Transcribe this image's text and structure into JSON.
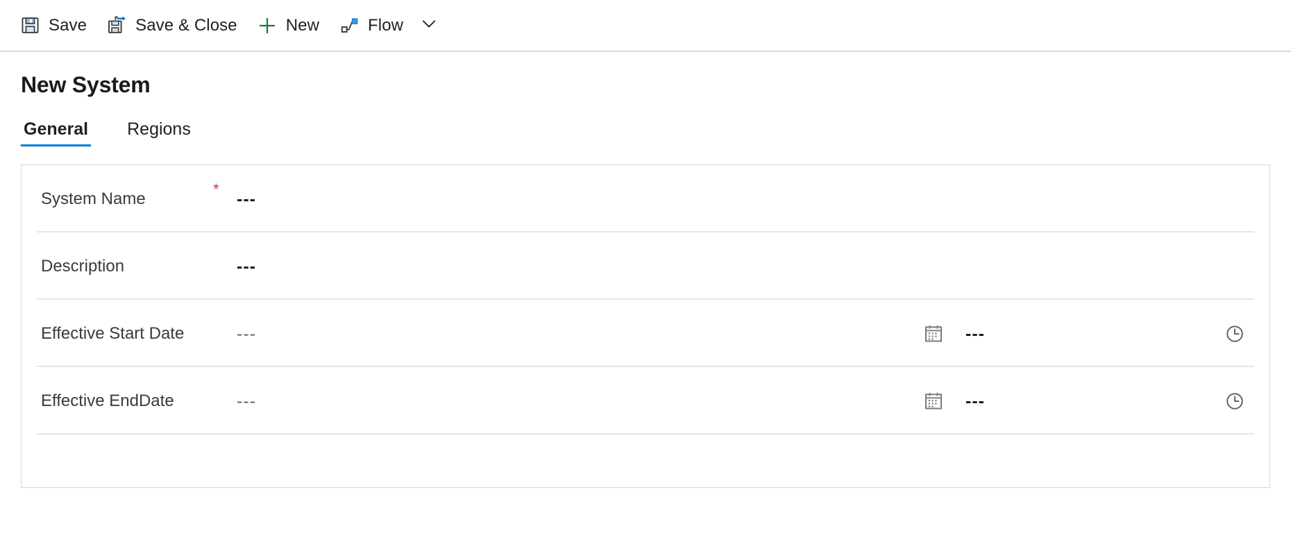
{
  "commandbar": {
    "buttons": [
      {
        "label": "Save",
        "icon": "save-icon"
      },
      {
        "label": "Save & Close",
        "icon": "save-and-close-icon"
      },
      {
        "label": "New",
        "icon": "plus-icon"
      },
      {
        "label": "Flow",
        "icon": "flow-icon"
      }
    ],
    "overflow_icon": "chevron-down-icon"
  },
  "page": {
    "title": "New System"
  },
  "tabs": [
    {
      "label": "General",
      "active": true
    },
    {
      "label": "Regions",
      "active": false
    }
  ],
  "form": {
    "rows": [
      {
        "label": "System Name",
        "required": true,
        "required_marker": "*",
        "value": "---",
        "type": "text"
      },
      {
        "label": "Description",
        "required": false,
        "required_marker": "",
        "value": "---",
        "type": "text"
      },
      {
        "label": "Effective Start Date",
        "required": false,
        "required_marker": "",
        "value": "---",
        "time_value": "---",
        "date_icon": "calendar-icon",
        "time_icon": "clock-icon",
        "type": "datetime"
      },
      {
        "label": "Effective EndDate",
        "required": false,
        "required_marker": "",
        "value": "---",
        "time_value": "---",
        "date_icon": "calendar-icon",
        "time_icon": "clock-icon",
        "type": "datetime"
      }
    ]
  },
  "colors": {
    "accent": "#0078d4",
    "required": "#d13438",
    "new_plus": "#107c41",
    "text": "#201f1e",
    "border": "#d6d6d6",
    "separator": "#e5e5e5"
  }
}
